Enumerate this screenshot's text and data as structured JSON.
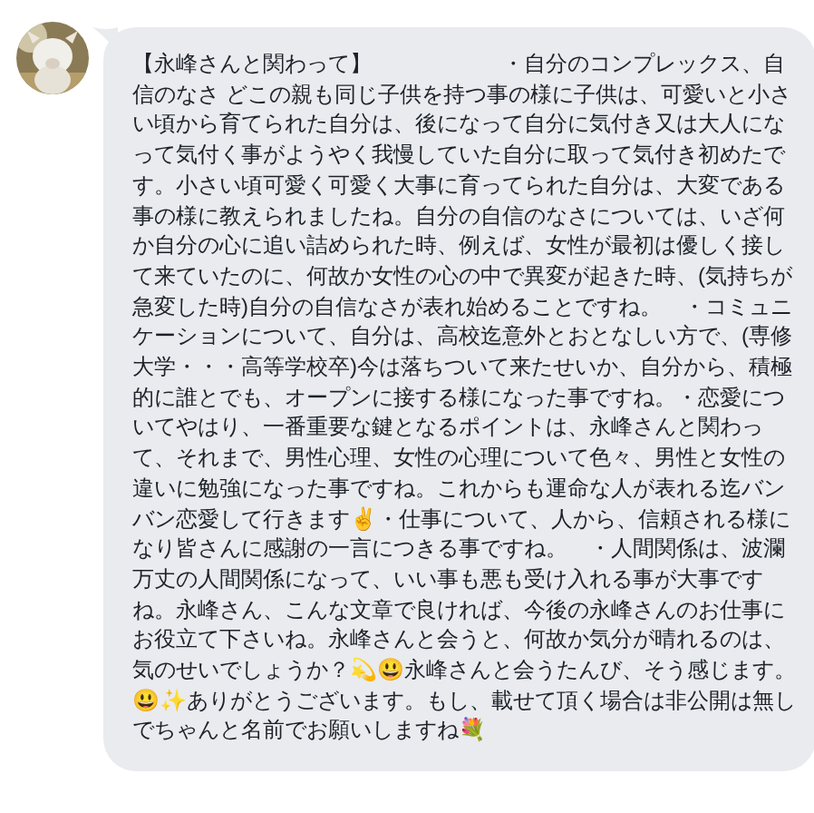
{
  "message": {
    "text": "【永峰さんと関わって】　　　　　　・自分のコンプレックス、自信のなさ どこの親も同じ子供を持つ事の様に子供は、可愛いと小さい頃から育てられた自分は、後になって自分に気付き又は大人になって気付く事がようやく我慢していた自分に取って気付き初めたです。小さい頃可愛く可愛く大事に育ってられた自分は、大変である事の様に教えられましたね。自分の自信のなさについては、いざ何か自分の心に追い詰められた時、例えば、女性が最初は優しく接して来ていたのに、何故か女性の心の中で異変が起きた時、(気持ちが急変した時)自分の自信なさが表れ始めることですね。　・コミュニケーションについて、自分は、高校迄意外とおとなしい方で、(専修大学・・・高等学校卒)今は落ちついて来たせいか、自分から、積極的に誰とでも、オープンに接する様になった事ですね。・恋愛についてやはり、一番重要な鍵となるポイントは、永峰さんと関わって、それまで、男性心理、女性の心理について色々、男性と女性の違いに勉強になった事ですね。これからも運命な人が表れる迄バンバン恋愛して行きます✌️・仕事について、人から、信頼される様になり皆さんに感謝の一言につきる事ですね。　・人間関係は、波瀾万丈の人間関係になって、いい事も悪も受け入れる事が大事ですね。永峰さん、こんな文章で良ければ、今後の永峰さんのお仕事にお役立て下さいね。永峰さんと会うと、何故か気分が晴れるのは、気のせいでしょうか？💫😃永峰さんと会うたんび、そう感じます。😃✨ありがとうございます。もし、載せて頂く場合は非公開は無しでちゃんと名前でお願いしますね💐"
  }
}
